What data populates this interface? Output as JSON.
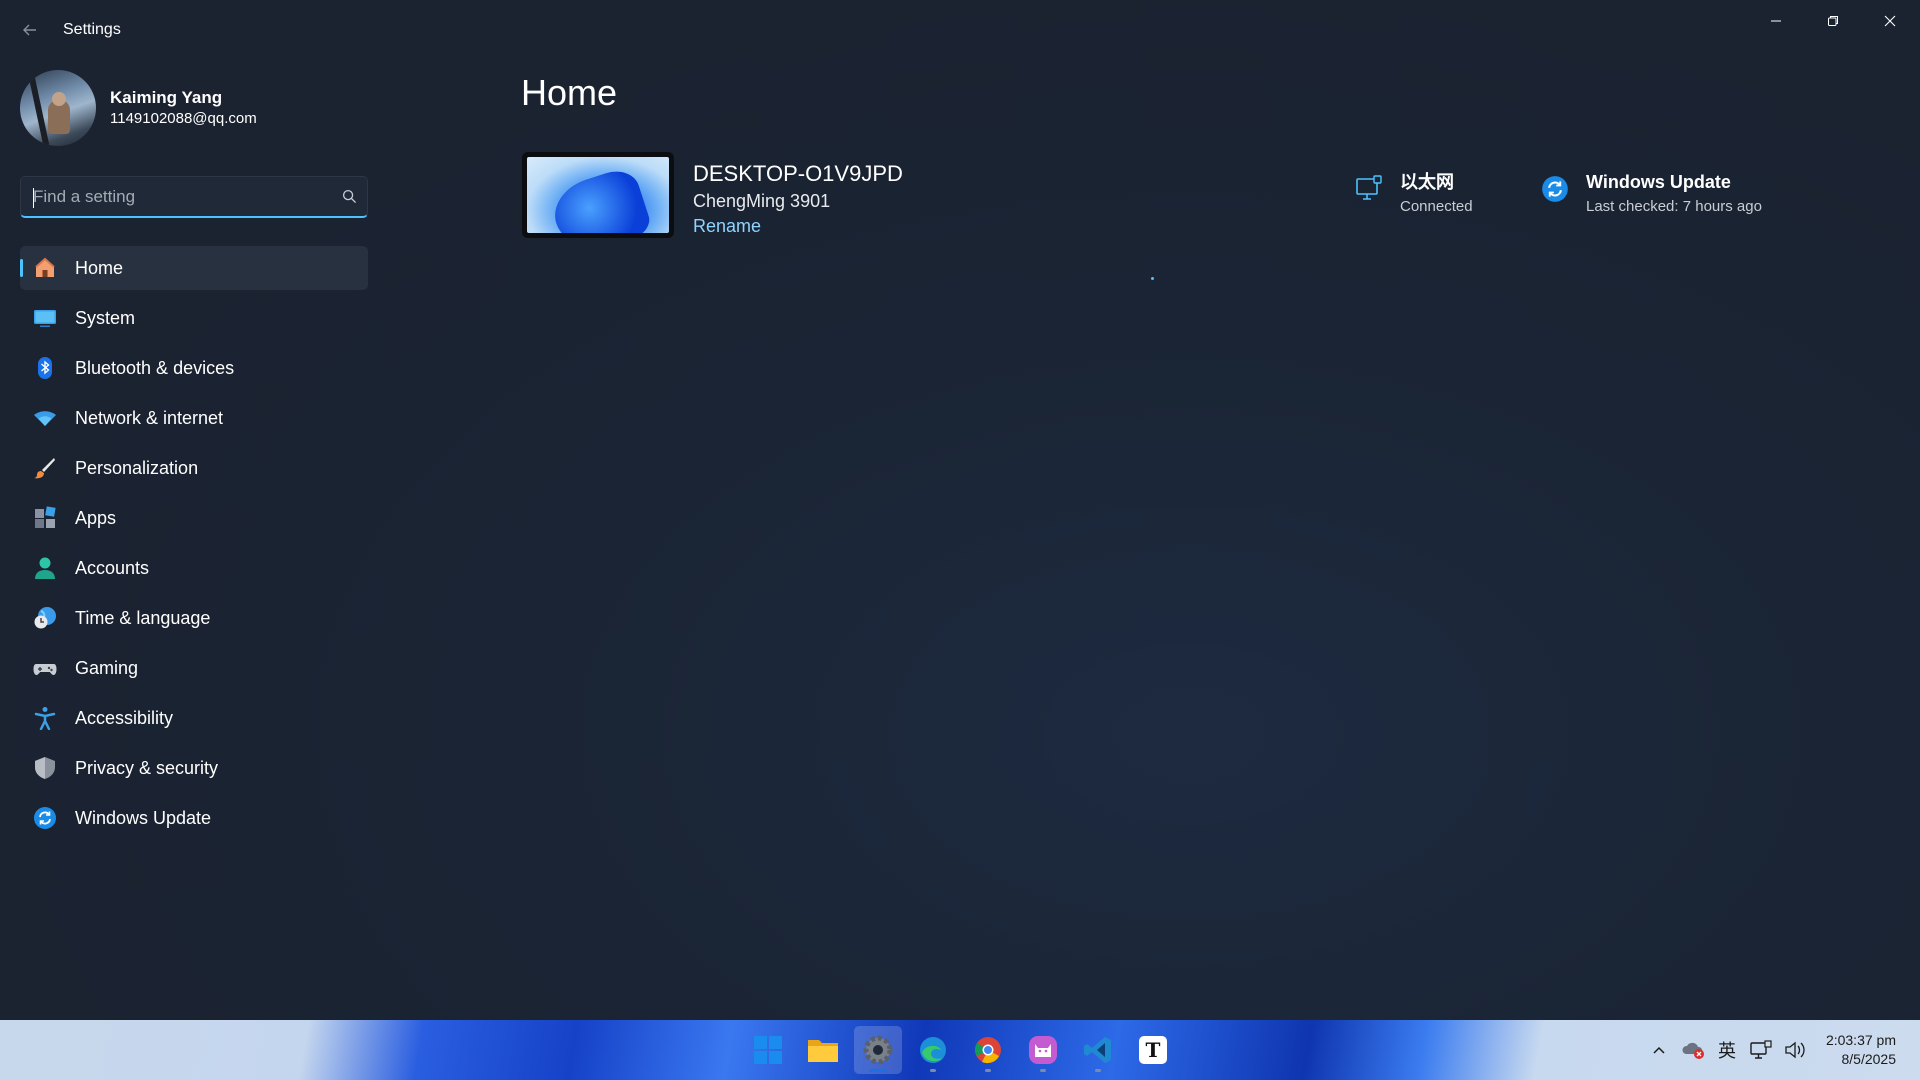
{
  "window": {
    "title": "Settings",
    "controls": {
      "minimize": "minimize",
      "restore": "restore",
      "close": "close"
    }
  },
  "profile": {
    "name": "Kaiming Yang",
    "email": "1149102088@qq.com"
  },
  "search": {
    "placeholder": "Find a setting",
    "value": ""
  },
  "nav": {
    "items": [
      {
        "label": "Home",
        "icon": "home-icon",
        "selected": true
      },
      {
        "label": "System",
        "icon": "system-icon"
      },
      {
        "label": "Bluetooth & devices",
        "icon": "bluetooth-icon"
      },
      {
        "label": "Network & internet",
        "icon": "wifi-icon"
      },
      {
        "label": "Personalization",
        "icon": "brush-icon"
      },
      {
        "label": "Apps",
        "icon": "apps-icon"
      },
      {
        "label": "Accounts",
        "icon": "accounts-icon"
      },
      {
        "label": "Time & language",
        "icon": "time-language-icon"
      },
      {
        "label": "Gaming",
        "icon": "gamepad-icon"
      },
      {
        "label": "Accessibility",
        "icon": "accessibility-icon"
      },
      {
        "label": "Privacy & security",
        "icon": "shield-icon"
      },
      {
        "label": "Windows Update",
        "icon": "windows-update-icon"
      }
    ]
  },
  "main": {
    "title": "Home",
    "device": {
      "name": "DESKTOP-O1V9JPD",
      "model": "ChengMing 3901",
      "rename_label": "Rename"
    },
    "network": {
      "title": "以太网",
      "status": "Connected"
    },
    "update": {
      "title": "Windows Update",
      "status": "Last checked: 7 hours ago"
    }
  },
  "taskbar": {
    "apps": [
      "start-icon",
      "file-explorer-icon",
      "settings-icon",
      "edge-icon",
      "chrome-icon",
      "cat-app-icon",
      "vscode-icon",
      "typora-icon"
    ],
    "typora_letter": "T",
    "tray": {
      "ime": "英",
      "time": "2:03:37 pm",
      "date": "8/5/2025"
    }
  },
  "colors": {
    "accent": "#4cc2ff",
    "background": "#1a2332",
    "selected_nav": "#28313f"
  }
}
